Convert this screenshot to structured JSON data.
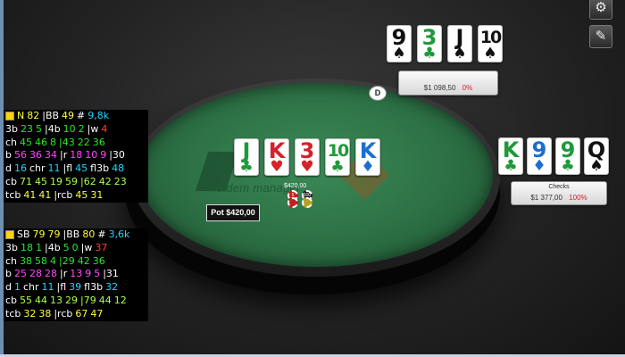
{
  "toolbar": {
    "settings_icon": "gear-icon",
    "edit_icon": "pencil-icon",
    "settings_glyph": "⚙",
    "edit_glyph": "✎"
  },
  "table": {
    "logo_text": "holdem manager",
    "dealer_label": "D",
    "pot_label": "Pot $420,00",
    "pot_amount": "$420,00",
    "chips": [
      "5",
      "100"
    ]
  },
  "board": {
    "cards": [
      {
        "rank": "J",
        "suit": "♣",
        "suit_name": "club"
      },
      {
        "rank": "K",
        "suit": "♥",
        "suit_name": "heart"
      },
      {
        "rank": "3",
        "suit": "♥",
        "suit_name": "heart"
      },
      {
        "rank": "10",
        "suit": "♣",
        "suit_name": "club"
      },
      {
        "rank": "K",
        "suit": "♦",
        "suit_name": "diamond"
      }
    ]
  },
  "seat_top": {
    "cards": [
      {
        "rank": "9",
        "suit": "♠",
        "suit_name": "spade"
      },
      {
        "rank": "3",
        "suit": "♣",
        "suit_name": "club"
      },
      {
        "rank": "J",
        "suit": "♠",
        "suit_name": "spade"
      },
      {
        "rank": "10",
        "suit": "♠",
        "suit_name": "spade"
      }
    ],
    "stack": "$1 098,50",
    "pct": "0%"
  },
  "seat_right": {
    "cards": [
      {
        "rank": "K",
        "suit": "♣",
        "suit_name": "club"
      },
      {
        "rank": "9",
        "suit": "♦",
        "suit_name": "diamond"
      },
      {
        "rank": "9",
        "suit": "♣",
        "suit_name": "club"
      },
      {
        "rank": "Q",
        "suit": "♠",
        "suit_name": "spade"
      }
    ],
    "action": "Checks",
    "stack": "$1 377,00",
    "pct": "100%"
  },
  "hud_top": {
    "rows": [
      [
        {
          "t": "N",
          "c": "y",
          "icon": true
        },
        {
          "t": "82",
          "c": "y"
        },
        {
          "t": "|BB",
          "c": "w"
        },
        {
          "t": "49",
          "c": "y"
        },
        {
          "t": "#",
          "c": "w"
        },
        {
          "t": "9,8k",
          "c": "c"
        }
      ],
      [
        {
          "t": "3b",
          "c": "w"
        },
        {
          "t": "23",
          "c": "g"
        },
        {
          "t": "5",
          "c": "g"
        },
        {
          "t": "|4b",
          "c": "w"
        },
        {
          "t": "10",
          "c": "g"
        },
        {
          "t": "2",
          "c": "g"
        },
        {
          "t": "|w",
          "c": "w"
        },
        {
          "t": "4",
          "c": "r"
        }
      ],
      [
        {
          "t": "ch",
          "c": "w"
        },
        {
          "t": "45",
          "c": "g"
        },
        {
          "t": "46",
          "c": "g"
        },
        {
          "t": "8",
          "c": "g"
        },
        {
          "t": "|43",
          "c": "g"
        },
        {
          "t": "22",
          "c": "g"
        },
        {
          "t": "36",
          "c": "g"
        }
      ],
      [
        {
          "t": "b",
          "c": "w"
        },
        {
          "t": "56",
          "c": "m"
        },
        {
          "t": "36",
          "c": "m"
        },
        {
          "t": "34",
          "c": "m"
        },
        {
          "t": "|r",
          "c": "w"
        },
        {
          "t": "18",
          "c": "m"
        },
        {
          "t": "10",
          "c": "m"
        },
        {
          "t": "9",
          "c": "m"
        },
        {
          "t": "|30",
          "c": "w"
        }
      ],
      [
        {
          "t": "d",
          "c": "w"
        },
        {
          "t": "16",
          "c": "c"
        },
        {
          "t": "chr",
          "c": "w"
        },
        {
          "t": "11",
          "c": "c"
        },
        {
          "t": "|fl",
          "c": "w"
        },
        {
          "t": "45",
          "c": "c"
        },
        {
          "t": "fl3b",
          "c": "w"
        },
        {
          "t": "48",
          "c": "c"
        }
      ],
      [
        {
          "t": "cb",
          "c": "w"
        },
        {
          "t": "71",
          "c": "lg"
        },
        {
          "t": "45",
          "c": "lg"
        },
        {
          "t": "19",
          "c": "lg"
        },
        {
          "t": "59",
          "c": "lg"
        },
        {
          "t": "|62",
          "c": "lg"
        },
        {
          "t": "42",
          "c": "lg"
        },
        {
          "t": "23",
          "c": "lg"
        }
      ],
      [
        {
          "t": "tcb",
          "c": "w"
        },
        {
          "t": "41",
          "c": "y"
        },
        {
          "t": "41",
          "c": "y"
        },
        {
          "t": "|rcb",
          "c": "w"
        },
        {
          "t": "45",
          "c": "y"
        },
        {
          "t": "31",
          "c": "y"
        }
      ]
    ]
  },
  "hud_bottom": {
    "rows": [
      [
        {
          "t": "SB",
          "c": "w",
          "icon": true
        },
        {
          "t": "79",
          "c": "y"
        },
        {
          "t": "79",
          "c": "y"
        },
        {
          "t": "|BB",
          "c": "w"
        },
        {
          "t": "80",
          "c": "y"
        },
        {
          "t": "#",
          "c": "w"
        },
        {
          "t": "3,6k",
          "c": "c"
        }
      ],
      [
        {
          "t": "3b",
          "c": "w"
        },
        {
          "t": "18",
          "c": "g"
        },
        {
          "t": "1",
          "c": "g"
        },
        {
          "t": "|4b",
          "c": "w"
        },
        {
          "t": "5",
          "c": "g"
        },
        {
          "t": "0",
          "c": "g"
        },
        {
          "t": "|w",
          "c": "w"
        },
        {
          "t": "37",
          "c": "r"
        }
      ],
      [
        {
          "t": "ch",
          "c": "w"
        },
        {
          "t": "38",
          "c": "g"
        },
        {
          "t": "58",
          "c": "g"
        },
        {
          "t": "4",
          "c": "g"
        },
        {
          "t": "|29",
          "c": "g"
        },
        {
          "t": "42",
          "c": "g"
        },
        {
          "t": "36",
          "c": "g"
        }
      ],
      [
        {
          "t": "b",
          "c": "w"
        },
        {
          "t": "25",
          "c": "m"
        },
        {
          "t": "28",
          "c": "m"
        },
        {
          "t": "28",
          "c": "m"
        },
        {
          "t": "|r",
          "c": "w"
        },
        {
          "t": "13",
          "c": "m"
        },
        {
          "t": "9",
          "c": "m"
        },
        {
          "t": "5",
          "c": "m"
        },
        {
          "t": "|31",
          "c": "w"
        }
      ],
      [
        {
          "t": "d",
          "c": "w"
        },
        {
          "t": "1",
          "c": "c"
        },
        {
          "t": "chr",
          "c": "w"
        },
        {
          "t": "11",
          "c": "c"
        },
        {
          "t": "|fl",
          "c": "w"
        },
        {
          "t": "39",
          "c": "c"
        },
        {
          "t": "fl3b",
          "c": "w"
        },
        {
          "t": "32",
          "c": "c"
        }
      ],
      [
        {
          "t": "cb",
          "c": "w"
        },
        {
          "t": "55",
          "c": "lg"
        },
        {
          "t": "44",
          "c": "lg"
        },
        {
          "t": "13",
          "c": "lg"
        },
        {
          "t": "29",
          "c": "lg"
        },
        {
          "t": "|79",
          "c": "lg"
        },
        {
          "t": "44",
          "c": "lg"
        },
        {
          "t": "12",
          "c": "lg"
        }
      ],
      [
        {
          "t": "tcb",
          "c": "w"
        },
        {
          "t": "32",
          "c": "y"
        },
        {
          "t": "38",
          "c": "y"
        },
        {
          "t": "|rcb",
          "c": "w"
        },
        {
          "t": "67",
          "c": "y"
        },
        {
          "t": "47",
          "c": "y"
        }
      ]
    ]
  }
}
